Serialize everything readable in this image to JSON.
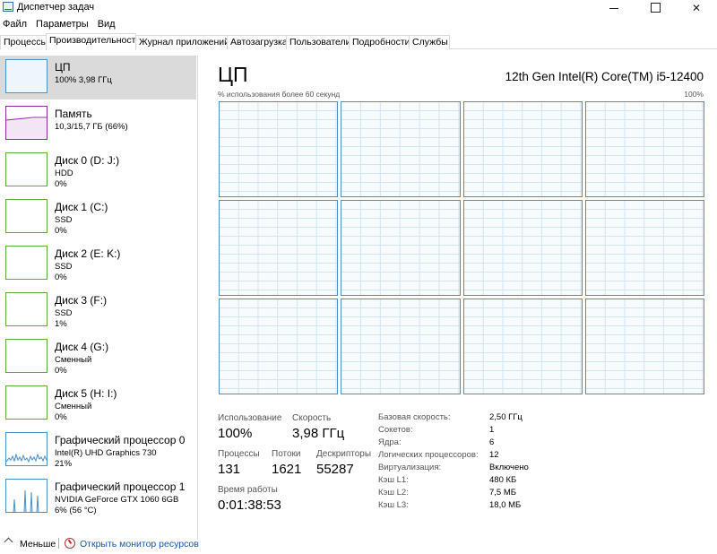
{
  "window": {
    "title": "Диспетчер задач"
  },
  "menu": [
    "Файл",
    "Параметры",
    "Вид"
  ],
  "tabs": [
    "Процессы",
    "Производительность",
    "Журнал приложений",
    "Автозагрузка",
    "Пользователи",
    "Подробности",
    "Службы"
  ],
  "active_tab": "Производительность",
  "devices": [
    {
      "name": "ЦП",
      "line2": "100% 3,98 ГГц",
      "line3": "",
      "color": "#4a90c8",
      "selected": true
    },
    {
      "name": "Память",
      "line2": "10,3/15,7 ГБ (66%)",
      "line3": "",
      "color": "#8b2ea0"
    },
    {
      "name": "Диск 0 (D: J:)",
      "line2": "HDD",
      "line3": "0%",
      "color": "#5ea93a"
    },
    {
      "name": "Диск 1 (C:)",
      "line2": "SSD",
      "line3": "0%",
      "color": "#5ea93a"
    },
    {
      "name": "Диск 2 (E: K:)",
      "line2": "SSD",
      "line3": "0%",
      "color": "#5ea93a"
    },
    {
      "name": "Диск 3 (F:)",
      "line2": "SSD",
      "line3": "1%",
      "color": "#5ea93a"
    },
    {
      "name": "Диск 4 (G:)",
      "line2": "Сменный",
      "line3": "0%",
      "color": "#5ea93a"
    },
    {
      "name": "Диск 5 (H: I:)",
      "line2": "Сменный",
      "line3": "0%",
      "color": "#5ea93a"
    },
    {
      "name": "Графический процессор 0",
      "line2": "Intel(R) UHD Graphics 730",
      "line3": "21%",
      "color": "#4a90c8"
    },
    {
      "name": "Графический процессор 1",
      "line2": "NVIDIA GeForce GTX 1060 6GB",
      "line3": "6% (56 °C)",
      "color": "#4a90c8"
    }
  ],
  "cpu": {
    "heading": "ЦП",
    "model": "12th Gen Intel(R) Core(TM) i5-12400",
    "graph_caption": "% использования более 60 секунд",
    "graph_max": "100%",
    "logical_cores_graphs": 12,
    "stats": {
      "usage_label": "Использование",
      "usage_value": "100%",
      "speed_label": "Скорость",
      "speed_value": "3,98 ГГц",
      "processes_label": "Процессы",
      "processes_value": "131",
      "threads_label": "Потоки",
      "threads_value": "1621",
      "handles_label": "Дескрипторы",
      "handles_value": "55287",
      "uptime_label": "Время работы",
      "uptime_value": "0:01:38:53"
    },
    "details": [
      {
        "key": "Базовая скорость:",
        "value": "2,50 ГГц"
      },
      {
        "key": "Сокетов:",
        "value": "1"
      },
      {
        "key": "Ядра:",
        "value": "6"
      },
      {
        "key": "Логических процессоров:",
        "value": "12"
      },
      {
        "key": "Виртуализация:",
        "value": "Включено"
      },
      {
        "key": "Кэш L1:",
        "value": "480 КБ"
      },
      {
        "key": "Кэш L2:",
        "value": "7,5 МБ"
      },
      {
        "key": "Кэш L3:",
        "value": "18,0 МБ"
      }
    ]
  },
  "footer": {
    "less_label": "Меньше",
    "monitor_label": "Открыть монитор ресурсов"
  }
}
